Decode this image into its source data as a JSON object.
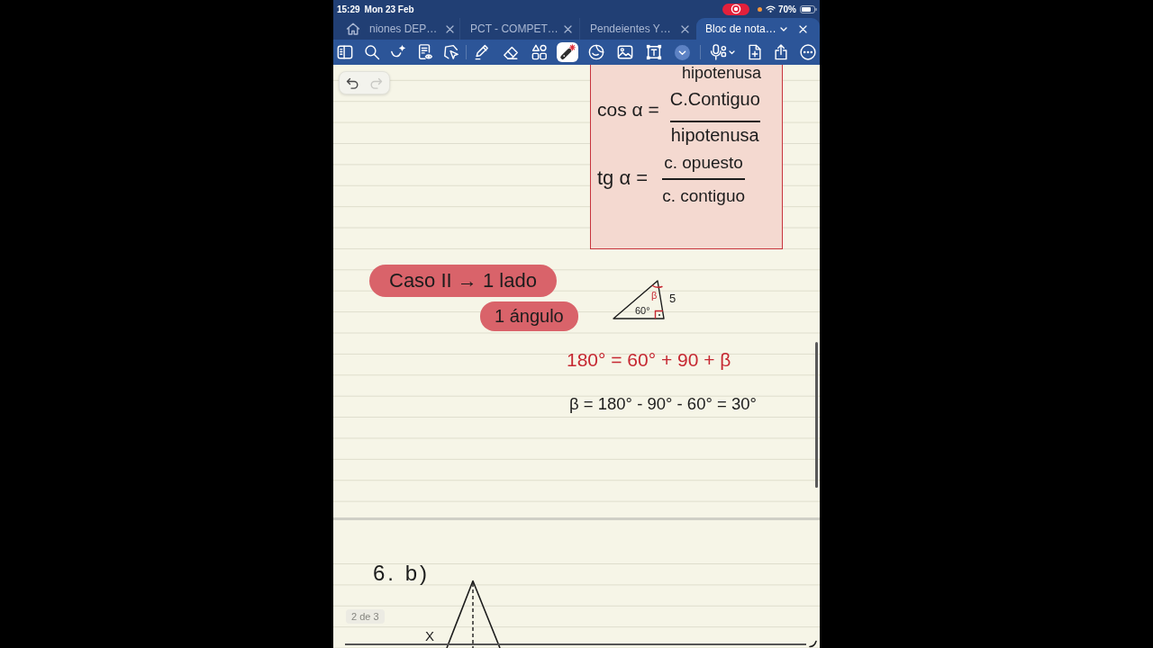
{
  "status_bar": {
    "time": "15:29",
    "date": "Mon 23 Feb",
    "recording": true,
    "microphone_active": true,
    "battery": "70%"
  },
  "tabs": [
    {
      "label": "niones DEP…",
      "selected": false
    },
    {
      "label": "PCT - COMPET…",
      "selected": false
    },
    {
      "label": "Pendeientes Y…",
      "selected": false
    },
    {
      "label": "Bloc de nota…",
      "selected": true
    }
  ],
  "toolbar": {
    "groups": [
      {
        "tools": [
          {
            "kind": "panel",
            "selected": false
          },
          {
            "kind": "search",
            "selected": false
          },
          {
            "kind": "assist",
            "selected": false
          },
          {
            "kind": "reader",
            "selected": false
          },
          {
            "kind": "lasso",
            "selected": false
          }
        ]
      },
      {
        "tools": [
          {
            "kind": "pen",
            "selected": false
          },
          {
            "kind": "eraser",
            "selected": false
          },
          {
            "kind": "shapes",
            "selected": false
          },
          {
            "kind": "laser",
            "selected": true
          },
          {
            "kind": "sticker",
            "selected": false
          },
          {
            "kind": "image",
            "selected": false
          },
          {
            "kind": "textbox",
            "selected": false
          },
          {
            "kind": "expand",
            "selected": false
          }
        ]
      },
      {
        "tools": [
          {
            "kind": "dictate",
            "selected": false
          },
          {
            "kind": "add_page",
            "selected": false
          },
          {
            "kind": "share",
            "selected": false
          },
          {
            "kind": "more",
            "selected": false
          }
        ]
      }
    ]
  },
  "history": [
    {
      "kind": "undo",
      "disabled": false
    },
    {
      "kind": "redo",
      "disabled": true
    }
  ],
  "page_1": {
    "formula_box": {
      "cut_line": "hipotenusa",
      "formulas": [
        {
          "lhs": "cos α =",
          "numerator": "C.Contiguo",
          "denominator": "hipotenusa"
        },
        {
          "lhs": "tg α =",
          "numerator": "c. opuesto",
          "denominator": "c. contiguo"
        }
      ]
    },
    "highlights": [
      "Caso II → 1 lado",
      "1 ángulo"
    ],
    "triangle": {
      "angle": "60°",
      "angle_unknown": "β",
      "side": "5"
    },
    "equations": [
      {
        "text": "180° = 60° + 90 + β",
        "color": "#c62832"
      },
      {
        "text": "β = 180° - 90° - 60° = 30°",
        "color": "#1c1c1c"
      }
    ]
  },
  "page_2": {
    "heading": "6. b)",
    "point_label": "X"
  },
  "page_indicator": "2 de 3"
}
